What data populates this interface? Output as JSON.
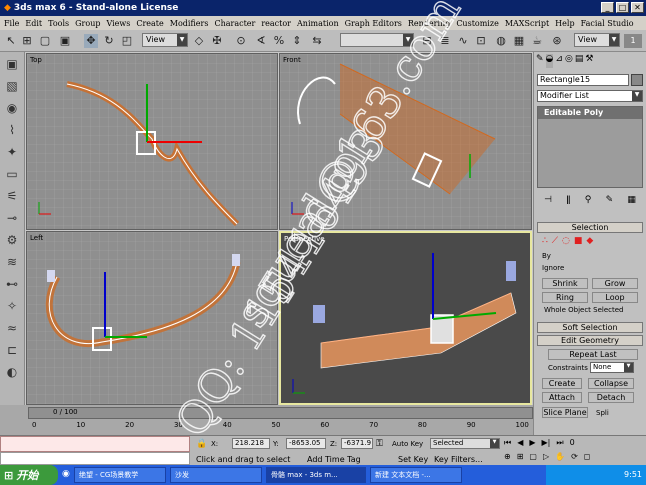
{
  "window": {
    "title": "3ds max 6 - Stand-alone License",
    "controls": [
      "_",
      "□",
      "✕"
    ]
  },
  "menu": [
    "File",
    "Edit",
    "Tools",
    "Group",
    "Views",
    "Create",
    "Modifiers",
    "Character",
    "reactor",
    "Animation",
    "Graph Editors",
    "Rendering",
    "Customize",
    "MAXScript",
    "Help",
    "Facial Studio"
  ],
  "toolbar": {
    "ref_coord": "View",
    "named_sel": "",
    "view_dd": "View",
    "render_num": "1"
  },
  "viewports": {
    "top": "Top",
    "front": "Front",
    "left": "Left",
    "perspective": "Perspective"
  },
  "command_panel": {
    "object_name": "Rectangle15",
    "modifier_list": "Modifier List",
    "stack_item": "Editable Poly",
    "selection_title": "Selection",
    "by_vertex": "By",
    "ignore_backfacing": "Ignore",
    "shrink": "Shrink",
    "grow": "Grow",
    "ring": "Ring",
    "loop": "Loop",
    "whole_object": "Whole Object Selected",
    "soft_selection": "Soft Selection",
    "edit_geometry": "Edit Geometry",
    "repeat_last": "Repeat Last",
    "constraints_label": "Constraints",
    "constraints_value": "None",
    "create": "Create",
    "collapse": "Collapse",
    "attach": "Attach",
    "detach": "Detach",
    "slice_plane": "Slice Plane",
    "split": "Spli"
  },
  "timeline": {
    "frame": "0 / 100",
    "ticks": [
      "0",
      "10",
      "20",
      "30",
      "40",
      "50",
      "60",
      "70",
      "80",
      "90",
      "100"
    ]
  },
  "status": {
    "x": "218.218",
    "y": "-8653.05",
    "z": "-6371.9",
    "x_label": "X:",
    "y_label": "Y:",
    "z_label": "Z:",
    "auto_key": "Auto Key",
    "selected": "Selected",
    "set_key": "Set Key",
    "key_filters": "Key Filters...",
    "prompt": "Click and drag to select",
    "add_time_tag": "Add Time Tag"
  },
  "taskbar": {
    "start": "开始",
    "tasks": [
      "绝望 - CG场景教学",
      "沙发",
      "骨骼 max - 3ds m...",
      "新建 文本文档 -..."
    ],
    "clock": "9:51"
  },
  "watermark": {
    "line1": "squeal@163.com",
    "line2": "QQ: 115416493"
  },
  "colors": {
    "title_bg": "#0a246a",
    "viewport_bg": "#8f8f8f",
    "perspective_bg": "#4a4a4a",
    "selection_red": "#e02020",
    "wire_orange": "#d2691e"
  }
}
